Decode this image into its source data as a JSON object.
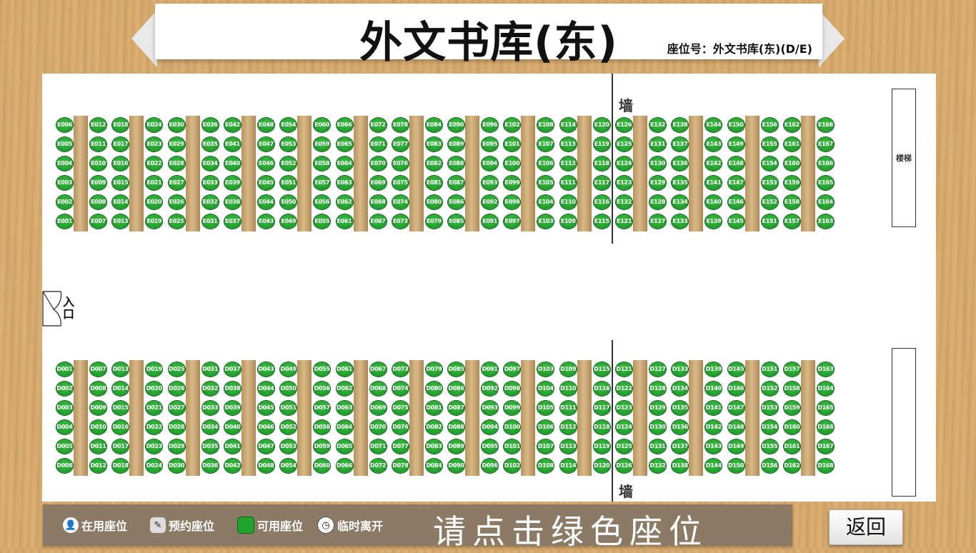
{
  "header": {
    "title": "外文书库(东)",
    "seat_code": "座位号：外文书库(东)(D/E)"
  },
  "map": {
    "wall_top_label": "墙",
    "wall_bottom_label": "墙",
    "stair_label": "楼梯",
    "entrance_label": "入口",
    "seat_status_color": "#1f9a2c",
    "sections": [
      {
        "prefix": "E",
        "start": 1,
        "order": "bottom-up"
      },
      {
        "prefix": "D",
        "start": 1,
        "order": "top-down"
      }
    ]
  },
  "legend": {
    "items": [
      {
        "label": "在用座位",
        "icon": "person-icon"
      },
      {
        "label": "预约座位",
        "icon": "note-icon"
      },
      {
        "label": "可用座位",
        "icon": "green-seat-icon"
      },
      {
        "label": "临时离开",
        "icon": "clock-icon"
      }
    ],
    "hint": "请点击绿色座位"
  },
  "back_button": "返回"
}
